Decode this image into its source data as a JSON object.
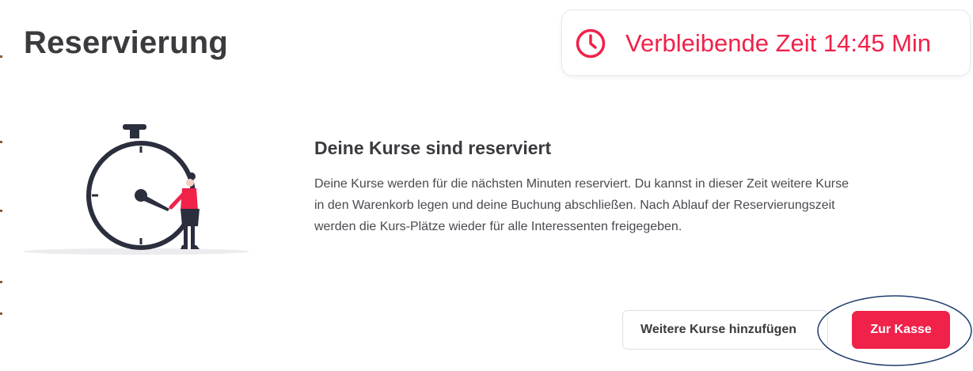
{
  "dialog": {
    "title": "Reservierung"
  },
  "timer": {
    "icon": "clock-icon",
    "text": "Verbleibende Zeit 14:45 Min",
    "color": "#f0224a"
  },
  "illustration": {
    "icon": "stopwatch-person-illustration"
  },
  "content": {
    "heading": "Deine Kurse sind reserviert",
    "line1": "Deine Kurse werden für die nächsten Minuten reserviert. Du kannst in dieser Zeit weitere Kurse",
    "line2": "in den Warenkorb legen und deine Buchung abschließen. Nach Ablauf der Reservierungszeit",
    "line3": "werden die Kurs-Plätze wieder für alle Interessenten freigegeben."
  },
  "actions": {
    "secondary_label": "Weitere Kurse hinzufügen",
    "primary_label": "Zur Kasse",
    "primary_color": "#f0224a",
    "highlight_color": "#1f3d6e"
  }
}
